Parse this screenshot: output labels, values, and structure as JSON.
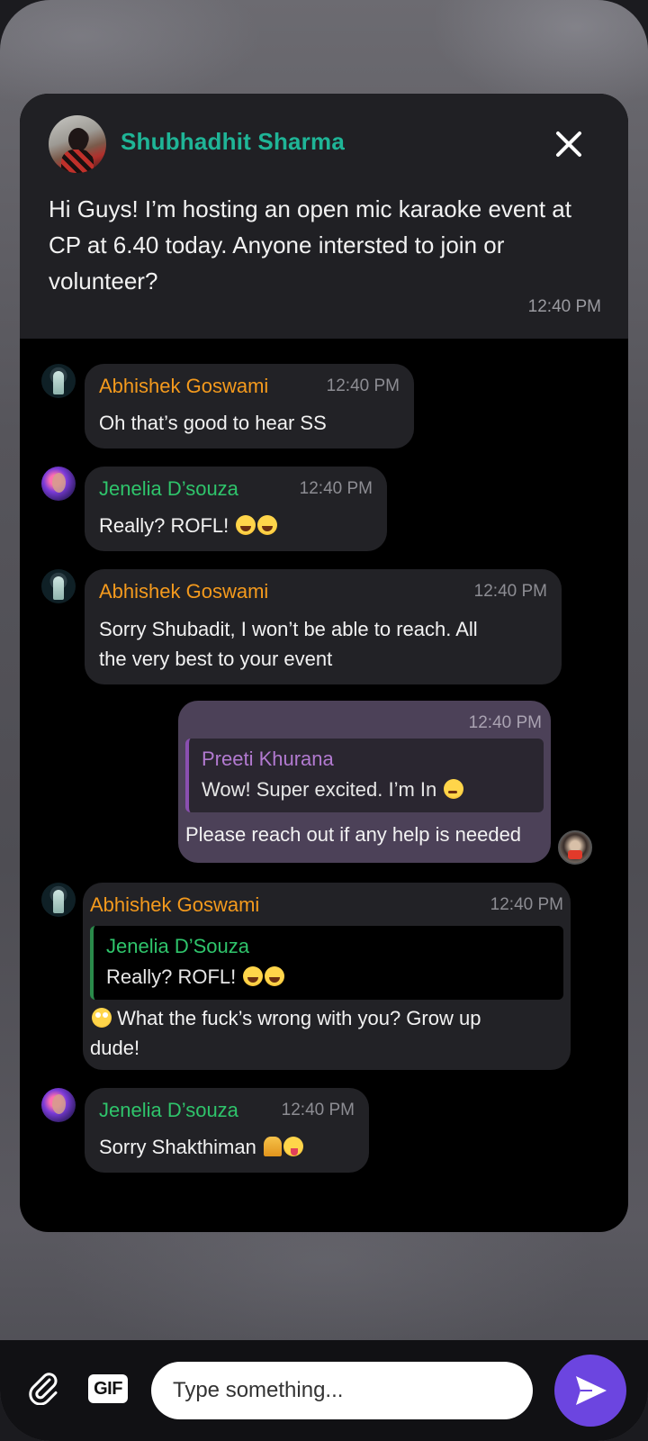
{
  "host_post": {
    "name": "Shubhadhit Sharma",
    "message": "Hi Guys! I’m hosting an open mic karaoke event at CP at 6.40 today. Anyone intersted to join or volunteer?",
    "time": "12:40 PM"
  },
  "messages": [
    {
      "sender": "Abhishek Goswami",
      "time": "12:40 PM",
      "text": "Oh that’s good to hear SS"
    },
    {
      "sender": "Jenelia D’souza",
      "time": "12:40 PM",
      "text": "Really? ROFL! "
    },
    {
      "sender": "Abhishek Goswami",
      "time": "12:40 PM",
      "text_line1": "Sorry Shubadit, I won’t be able to reach. All",
      "text_line2": "the very best to your event"
    },
    {
      "time": "12:40 PM",
      "quote_name": "Preeti Khurana",
      "quote_text": "Wow! Super excited. I’m In ",
      "text": "Please reach out if any help is needed"
    },
    {
      "sender": "Abhishek Goswami",
      "time": "12:40 PM",
      "quote_name": "Jenelia D’Souza",
      "quote_text": "Really? ROFL! ",
      "text_line1": " What the fuck’s wrong with you? Grow up",
      "text_line2": "dude!"
    },
    {
      "sender": "Jenelia D’souza",
      "time": "12:40 PM",
      "text": "Sorry Shakthiman "
    }
  ],
  "composer": {
    "gif_label": "GIF",
    "placeholder": "Type something..."
  },
  "colors": {
    "host_name": "#1fb597",
    "abhishek": "#f49a1d",
    "jenelia": "#2fc46b",
    "preeti": "#b27ad0",
    "send_button": "#6c45e0"
  },
  "icons": {
    "close": "close-icon",
    "attach": "paperclip-icon",
    "send": "send-icon"
  }
}
